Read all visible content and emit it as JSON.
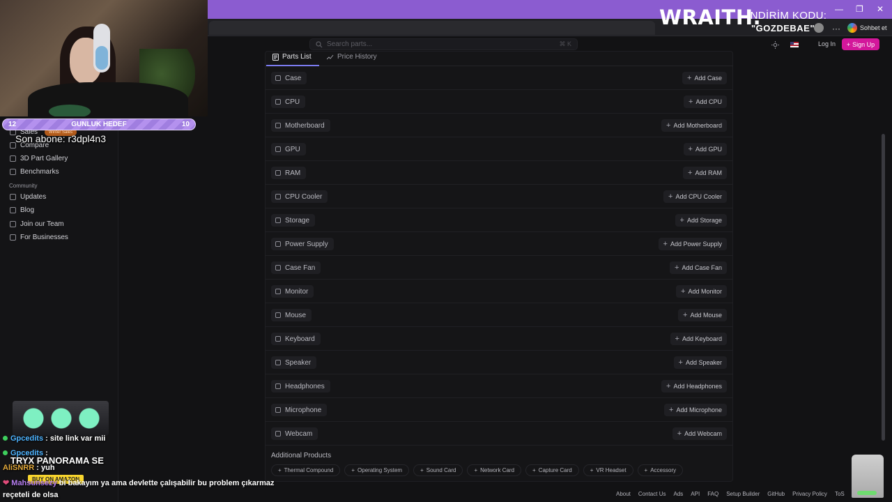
{
  "overlay": {
    "brand": "WRAITH.",
    "promo_label": "İNDİRİM KODU:",
    "promo_code": "\"GOZDEBAE\"",
    "goal_left": "12",
    "goal_title": "GUNLUK HEDEF",
    "goal_right": "10",
    "last_sub": "Son abone: r3dpl4n3",
    "chat_button": "Sohbet et",
    "minimize": "—",
    "restore": "❐",
    "close": "✕",
    "more": "···"
  },
  "header": {
    "search_placeholder": "Search parts...",
    "search_shortcut": "⌘ K",
    "login": "Log In",
    "signup": "Sign Up"
  },
  "sidebar": {
    "badge": "Winter Sales",
    "items": [
      {
        "label": "Sales"
      },
      {
        "label": "Compare"
      },
      {
        "label": "3D Part Gallery"
      },
      {
        "label": "Benchmarks"
      }
    ],
    "community_heading": "Community",
    "community_items": [
      {
        "label": "Updates"
      },
      {
        "label": "Blog"
      },
      {
        "label": "Join our Team"
      },
      {
        "label": "For Businesses"
      }
    ]
  },
  "tabs": {
    "parts_list": "Parts List",
    "price_history": "Price History"
  },
  "parts": [
    {
      "name": "Case",
      "add": "Add Case"
    },
    {
      "name": "CPU",
      "add": "Add CPU"
    },
    {
      "name": "Motherboard",
      "add": "Add Motherboard"
    },
    {
      "name": "GPU",
      "add": "Add GPU"
    },
    {
      "name": "RAM",
      "add": "Add RAM"
    },
    {
      "name": "CPU Cooler",
      "add": "Add CPU Cooler"
    },
    {
      "name": "Storage",
      "add": "Add Storage"
    },
    {
      "name": "Power Supply",
      "add": "Add Power Supply"
    },
    {
      "name": "Case Fan",
      "add": "Add Case Fan"
    },
    {
      "name": "Monitor",
      "add": "Add Monitor"
    },
    {
      "name": "Mouse",
      "add": "Add Mouse"
    },
    {
      "name": "Keyboard",
      "add": "Add Keyboard"
    },
    {
      "name": "Speaker",
      "add": "Add Speaker"
    },
    {
      "name": "Headphones",
      "add": "Add Headphones"
    },
    {
      "name": "Microphone",
      "add": "Add Microphone"
    },
    {
      "name": "Webcam",
      "add": "Add Webcam"
    }
  ],
  "additional": {
    "title": "Additional Products",
    "items": [
      "Thermal Compound",
      "Operating System",
      "Sound Card",
      "Network Card",
      "Capture Card",
      "VR Headset",
      "Accessory"
    ]
  },
  "footer": [
    "About",
    "Contact Us",
    "Ads",
    "API",
    "FAQ",
    "Setup Builder",
    "GitHub",
    "Privacy Policy",
    "ToS"
  ],
  "chat": {
    "line1_name": "Gpcedits",
    "line1_msg": ": site link var mii",
    "line2_name": "Gpcedits",
    "line2_msg": ":",
    "line3_name": "AliSNRR",
    "line3_msg": ": yuh",
    "promo_text": "TRYX PANORAMA SE",
    "buy_label": "BUY ON AMAZON",
    "msg_name": "Mahsunsezy",
    "msg_text": "bi bakayım ya ama devlette çalışabilir bu problem çıkarmaz reçeteli de olsa"
  }
}
